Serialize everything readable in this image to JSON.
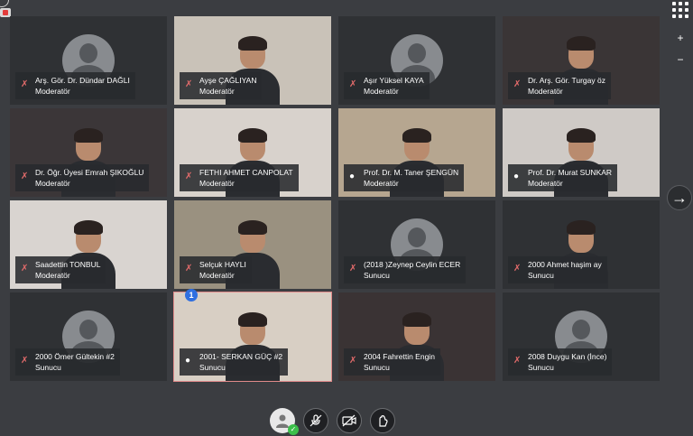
{
  "top_right": {
    "apps_icon": "grid-icon",
    "zoom_in": "+",
    "zoom_out": "−"
  },
  "next_page_icon": "→",
  "notification_count": "1",
  "tiles": [
    {
      "name": "Arş. Gör. Dr. Dündar DAĞLI",
      "role": "Moderatör",
      "mic": "muted",
      "video": false
    },
    {
      "name": "Ayşe ÇAĞLIYAN",
      "role": "Moderatör",
      "mic": "muted",
      "video": true
    },
    {
      "name": "Aşır Yüksel KAYA",
      "role": "Moderatör",
      "mic": "muted",
      "video": false
    },
    {
      "name": "Dr. Arş. Gör. Turgay öz",
      "role": "Moderatör",
      "mic": "muted",
      "video": true
    },
    {
      "name": "Dr. Öğr. Üyesi Emrah ŞIKOĞLU",
      "role": "Moderatör",
      "mic": "muted",
      "video": true
    },
    {
      "name": "FETHI AHMET CANPOLAT",
      "role": "Moderatör",
      "mic": "muted",
      "video": true
    },
    {
      "name": "Prof. Dr. M. Taner ŞENGÜN",
      "role": "Moderatör",
      "mic": "on",
      "video": true
    },
    {
      "name": "Prof. Dr. Murat SUNKAR",
      "role": "Moderatör",
      "mic": "on",
      "video": true
    },
    {
      "name": "Saadettin TONBUL",
      "role": "Moderatör",
      "mic": "muted",
      "video": true
    },
    {
      "name": "Selçuk HAYLI",
      "role": "Moderatör",
      "mic": "muted",
      "video": true
    },
    {
      "name": "(2018 )Zeynep Ceylin ECER",
      "role": "Sunucu",
      "mic": "muted",
      "video": false
    },
    {
      "name": "2000 Ahmet haşim ay",
      "role": "Sunucu",
      "mic": "muted",
      "video": true
    },
    {
      "name": "2000 Ömer Gültekin #2",
      "role": "Sunucu",
      "mic": "muted",
      "video": false
    },
    {
      "name": "2001- SERKAN GÜÇ #2",
      "role": "Sunucu",
      "mic": "on",
      "video": true
    },
    {
      "name": "2004 Fahrettin Engin",
      "role": "Sunucu",
      "mic": "muted",
      "video": true
    },
    {
      "name": "2008 Duygu Kan (İnce)",
      "role": "Sunucu",
      "mic": "muted",
      "video": false
    }
  ],
  "toolbar": {
    "mic_icon": "mic-muted-icon",
    "camera_icon": "camera-off-icon",
    "share_icon": "raise-hand-icon"
  }
}
